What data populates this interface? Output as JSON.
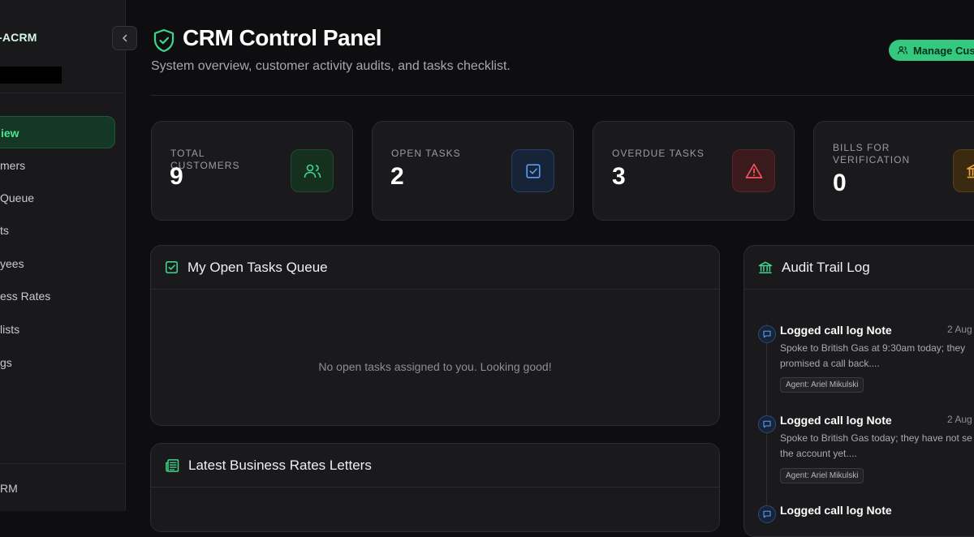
{
  "sidebar": {
    "brand": "-ACRM",
    "items": [
      {
        "label": "iew",
        "active": true
      },
      {
        "label": "mers"
      },
      {
        "label": " Queue"
      },
      {
        "label": "ts"
      },
      {
        "label": "yees"
      },
      {
        "label": "ess Rates"
      },
      {
        "label": "lists"
      },
      {
        "label": "gs"
      }
    ],
    "footer": "RM"
  },
  "header": {
    "title": "CRM Control Panel",
    "subtitle": "System overview, customer activity audits, and tasks checklist.",
    "manage_button": "Manage Cust"
  },
  "stats": [
    {
      "label": "TOTAL CUSTOMERS",
      "value": "9",
      "icon": "users-icon",
      "color": "#3fd58a"
    },
    {
      "label": "OPEN TASKS",
      "value": "2",
      "icon": "checkbox-icon",
      "color": "#5b9cf2"
    },
    {
      "label": "OVERDUE TASKS",
      "value": "3",
      "icon": "warning-icon",
      "color": "#f2555a"
    },
    {
      "label": "BILLS FOR VERIFICATION",
      "value": "0",
      "icon": "bank-icon",
      "color": "#e9a63a"
    }
  ],
  "tasks_panel": {
    "title": "My Open Tasks Queue",
    "empty_message": "No open tasks assigned to you. Looking good!"
  },
  "letters_panel": {
    "title": "Latest Business Rates Letters"
  },
  "audit_panel": {
    "title": "Audit Trail Log",
    "entries": [
      {
        "title": "Logged call log Note",
        "date": "2 Aug",
        "body_line1": "Spoke to British Gas at 9:30am today; they",
        "body_line2": "promised a call back....",
        "agent": "Agent: Ariel Mikulski"
      },
      {
        "title": "Logged call log Note",
        "date": "2 Aug",
        "body_line1": "Spoke to British Gas today; they have not se",
        "body_line2": "the account yet....",
        "agent": "Agent: Ariel Mikulski"
      },
      {
        "title": "Logged call log Note",
        "date": "",
        "body_line1": "",
        "body_line2": "",
        "agent": ""
      }
    ]
  },
  "colors": {
    "accent": "#34c97f",
    "background": "#0e0e10",
    "card": "#1a1a1d"
  }
}
